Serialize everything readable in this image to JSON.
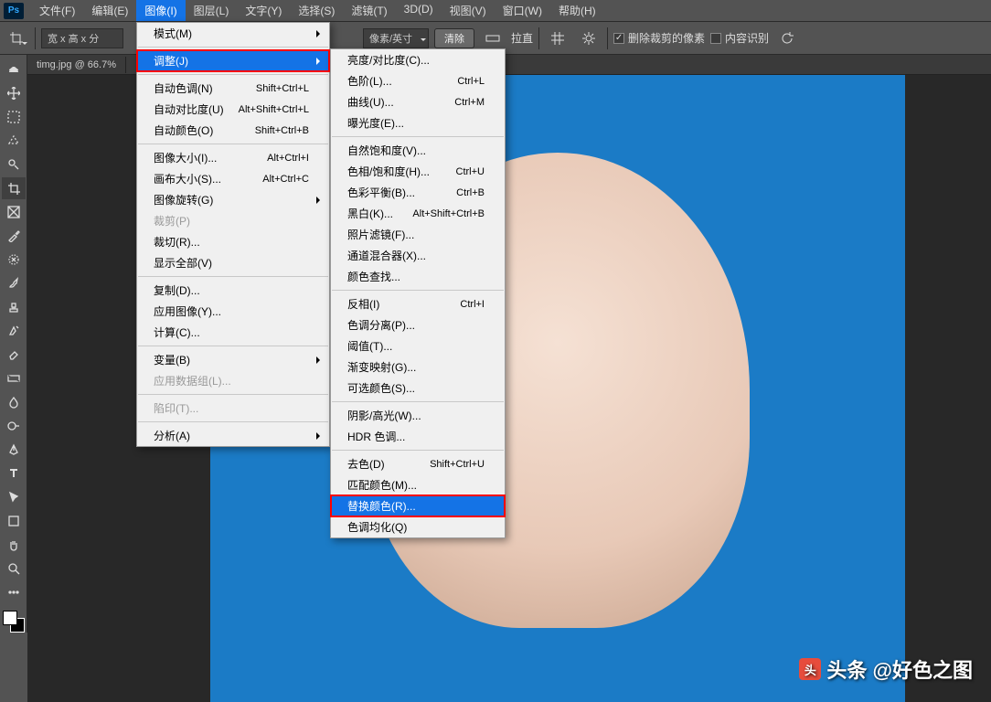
{
  "logo": "Ps",
  "menubar": [
    "文件(F)",
    "编辑(E)",
    "图像(I)",
    "图层(L)",
    "文字(Y)",
    "选择(S)",
    "滤镜(T)",
    "3D(D)",
    "视图(V)",
    "窗口(W)",
    "帮助(H)"
  ],
  "menubar_open_index": 2,
  "options": {
    "size_placeholder": "宽 x 高 x 分",
    "units": "像素/英寸",
    "clear": "清除",
    "straighten": "拉直",
    "del_crop": "删除裁剪的像素",
    "content_aware": "内容识别"
  },
  "doc_tab": "timg.jpg @ 66.7%",
  "image_menu": [
    {
      "label": "模式(M)",
      "sub": true
    },
    {
      "sep": true
    },
    {
      "label": "调整(J)",
      "sub": true,
      "hover": true,
      "red": true
    },
    {
      "sep": true
    },
    {
      "label": "自动色调(N)",
      "sc": "Shift+Ctrl+L"
    },
    {
      "label": "自动对比度(U)",
      "sc": "Alt+Shift+Ctrl+L"
    },
    {
      "label": "自动颜色(O)",
      "sc": "Shift+Ctrl+B"
    },
    {
      "sep": true
    },
    {
      "label": "图像大小(I)...",
      "sc": "Alt+Ctrl+I"
    },
    {
      "label": "画布大小(S)...",
      "sc": "Alt+Ctrl+C"
    },
    {
      "label": "图像旋转(G)",
      "sub": true
    },
    {
      "label": "裁剪(P)",
      "disabled": true
    },
    {
      "label": "裁切(R)..."
    },
    {
      "label": "显示全部(V)"
    },
    {
      "sep": true
    },
    {
      "label": "复制(D)..."
    },
    {
      "label": "应用图像(Y)..."
    },
    {
      "label": "计算(C)..."
    },
    {
      "sep": true
    },
    {
      "label": "变量(B)",
      "sub": true
    },
    {
      "label": "应用数据组(L)...",
      "disabled": true
    },
    {
      "sep": true
    },
    {
      "label": "陷印(T)...",
      "disabled": true
    },
    {
      "sep": true
    },
    {
      "label": "分析(A)",
      "sub": true
    }
  ],
  "adjust_menu": [
    {
      "label": "亮度/对比度(C)..."
    },
    {
      "label": "色阶(L)...",
      "sc": "Ctrl+L"
    },
    {
      "label": "曲线(U)...",
      "sc": "Ctrl+M"
    },
    {
      "label": "曝光度(E)..."
    },
    {
      "sep": true
    },
    {
      "label": "自然饱和度(V)..."
    },
    {
      "label": "色相/饱和度(H)...",
      "sc": "Ctrl+U"
    },
    {
      "label": "色彩平衡(B)...",
      "sc": "Ctrl+B"
    },
    {
      "label": "黑白(K)...",
      "sc": "Alt+Shift+Ctrl+B"
    },
    {
      "label": "照片滤镜(F)..."
    },
    {
      "label": "通道混合器(X)..."
    },
    {
      "label": "颜色查找..."
    },
    {
      "sep": true
    },
    {
      "label": "反相(I)",
      "sc": "Ctrl+I"
    },
    {
      "label": "色调分离(P)..."
    },
    {
      "label": "阈值(T)..."
    },
    {
      "label": "渐变映射(G)..."
    },
    {
      "label": "可选颜色(S)..."
    },
    {
      "sep": true
    },
    {
      "label": "阴影/高光(W)..."
    },
    {
      "label": "HDR 色调..."
    },
    {
      "sep": true
    },
    {
      "label": "去色(D)",
      "sc": "Shift+Ctrl+U"
    },
    {
      "label": "匹配颜色(M)..."
    },
    {
      "label": "替换颜色(R)...",
      "hover": true,
      "red": true
    },
    {
      "label": "色调均化(Q)"
    }
  ],
  "watermark": "头条 @好色之图"
}
